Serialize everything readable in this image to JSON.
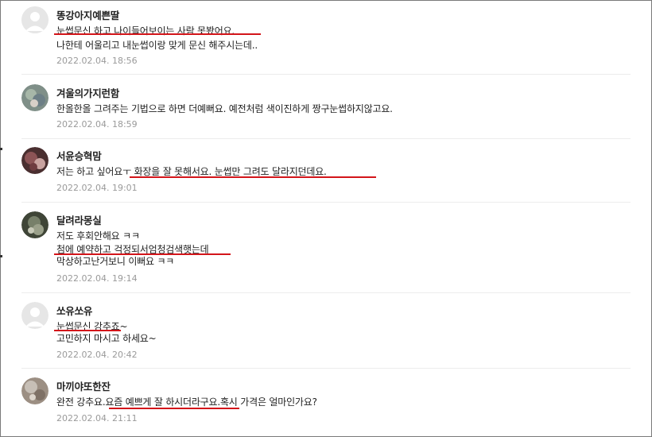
{
  "comments": [
    {
      "nickname": "똥강아지예쁜딸",
      "lines": [
        "눈썹문신 하고 나이들어보이는 사람 못봤어요.",
        "나한테 어울리고 내눈썹이랑 맞게 문신 해주시는데.."
      ],
      "date": "2022.02.04. 18:56",
      "avatar": "default-avatar-icon"
    },
    {
      "nickname": "겨울의가지런함",
      "lines": [
        "한올한올 그려주는 기법으로 하면 더예뻐요. 예전처럼 색이진하게 짱구눈썹하지않고요."
      ],
      "date": "2022.02.04. 18:59",
      "avatar": "profile-photo-icon"
    },
    {
      "nickname": "서윤승혁맘",
      "lines": [
        "저는 하고 싶어요ㅜ 화장을 잘 못해서요. 눈썹만 그려도 달라지던데요."
      ],
      "date": "2022.02.04. 19:01",
      "avatar": "profile-photo-icon"
    },
    {
      "nickname": "달려라몽실",
      "lines": [
        "저도 후회안해요 ㅋㅋ",
        "첨에 예약하고 걱정되서엄청검색햇는데",
        "막상하고난거보니 이뻐요 ㅋㅋ"
      ],
      "date": "2022.02.04. 19:14",
      "avatar": "profile-photo-icon"
    },
    {
      "nickname": "쏘유쏘유",
      "lines": [
        "눈썹문신 강추죠~",
        "고민하지 마시고 하세요~"
      ],
      "date": "2022.02.04. 20:42",
      "avatar": "default-avatar-icon"
    },
    {
      "nickname": "마끼야또한잔",
      "lines": [
        "완전 강추요.요즘 예쁘게 잘 하시더라구요.혹시 가격은 얼마인가요?"
      ],
      "date": "2022.02.04. 21:11",
      "avatar": "profile-photo-icon"
    }
  ],
  "colors": {
    "underline": "#d3151a",
    "date_text": "#9a9a9a",
    "divider": "#ececec"
  }
}
